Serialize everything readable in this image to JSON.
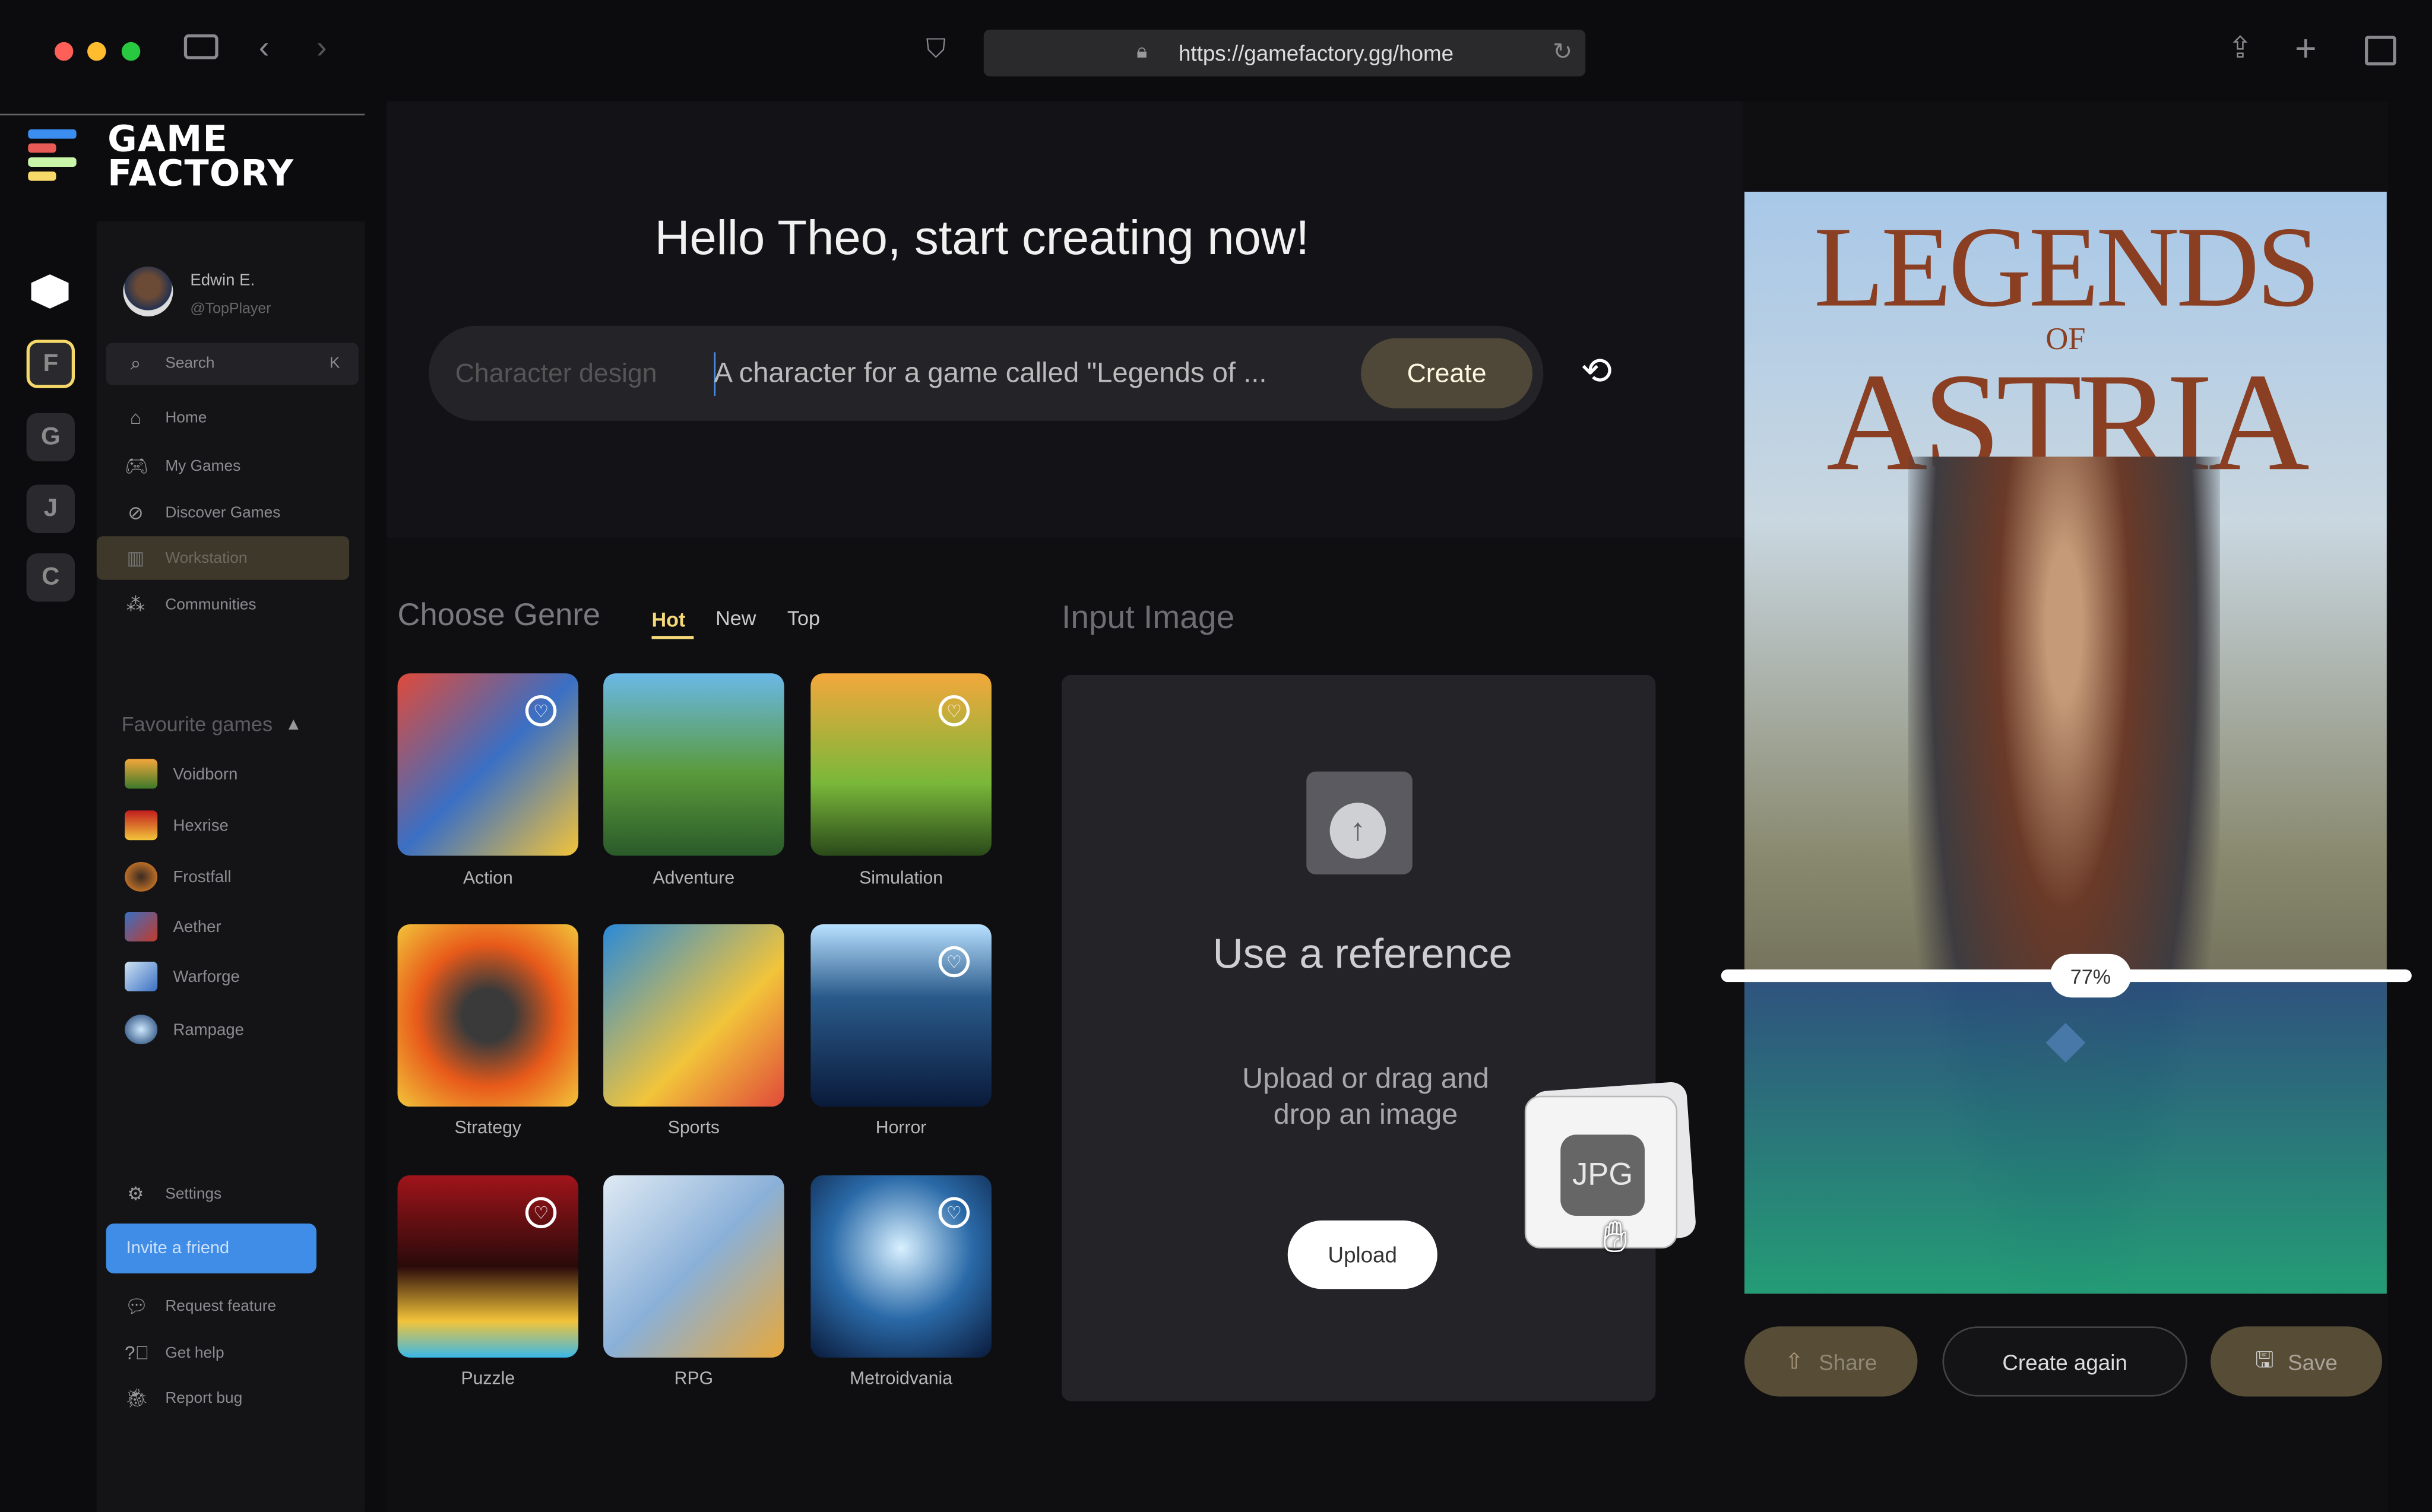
{
  "browser": {
    "url": "https://gamefactory.gg/home"
  },
  "brand": {
    "line1": "GAME",
    "line2": "FACTORY",
    "colors": [
      "#3b8ef0",
      "#e85a55",
      "#c8f5a8",
      "#f7d96a"
    ]
  },
  "rail": {
    "items": [
      "F",
      "G",
      "J",
      "C"
    ]
  },
  "user": {
    "name": "Edwin E.",
    "handle": "@TopPlayer"
  },
  "search": {
    "placeholder": "Search",
    "shortcut": "K"
  },
  "nav": [
    {
      "label": "Home",
      "icon": "home-icon"
    },
    {
      "label": "My Games",
      "icon": "gamepad-icon"
    },
    {
      "label": "Discover Games",
      "icon": "compass-icon"
    },
    {
      "label": "Workstation",
      "icon": "layout-icon",
      "active": true
    },
    {
      "label": "Communities",
      "icon": "community-icon"
    }
  ],
  "favourites": {
    "title": "Favourite games",
    "items": [
      "Voidborn",
      "Hexrise",
      "Frostfall",
      "Aether",
      "Warforge",
      "Rampage"
    ]
  },
  "footer_nav": {
    "settings": "Settings",
    "invite": "Invite a friend",
    "request": "Request feature",
    "help": "Get help",
    "bug": "Report bug"
  },
  "hero": {
    "title": "Hello Theo, start creating now!",
    "prompt_placeholder": "Character design",
    "prompt_value": "A character for a game called \"Legends of ...",
    "create": "Create"
  },
  "genre": {
    "title": "Choose Genre",
    "tabs": [
      "Hot",
      "New",
      "Top"
    ],
    "active_tab": "Hot",
    "items": [
      "Action",
      "Adventure",
      "Simulation",
      "Strategy",
      "Sports",
      "Horror",
      "Puzzle",
      "RPG",
      "Metroidvania"
    ]
  },
  "input_image": {
    "title": "Input Image",
    "heading": "Use a reference",
    "sub": "Upload or drag and drop an image",
    "upload": "Upload",
    "file_type": "JPG"
  },
  "result": {
    "poster_title": "LEGENDS",
    "poster_of": "OF",
    "poster_sub": "ASTRIA",
    "progress_percent": 77,
    "progress_label": "77%",
    "share": "Share",
    "create_again": "Create again",
    "save": "Save"
  },
  "accent": "#4a4234"
}
